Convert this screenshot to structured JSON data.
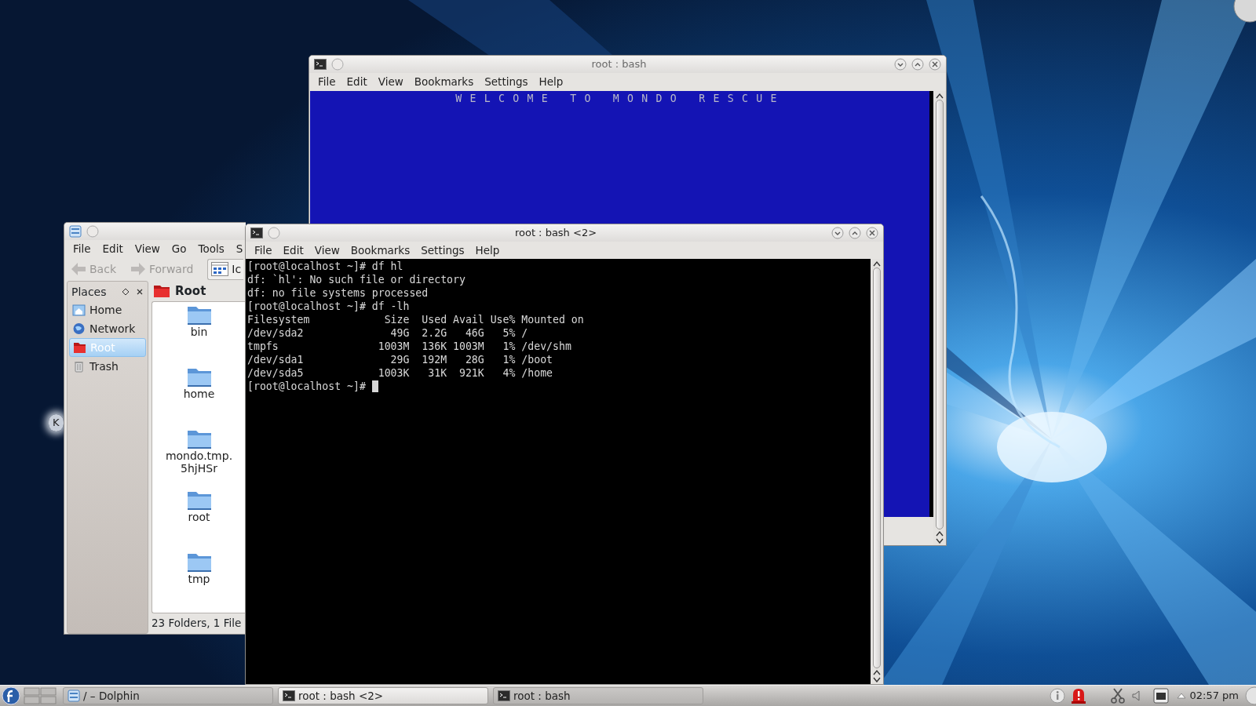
{
  "desktop": {
    "kind": "picture",
    "icon_labels": [
      "K"
    ]
  },
  "windows": [
    {
      "kind": "terminal",
      "title": "root : bash",
      "active": false,
      "menu": [
        "File",
        "Edit",
        "View",
        "Bookmarks",
        "Settings",
        "Help"
      ],
      "banner": "WELCOME TO MONDO RESCUE"
    },
    {
      "kind": "file_manager",
      "menu": [
        "File",
        "Edit",
        "View",
        "Go",
        "Tools",
        "S"
      ],
      "toolbar": [
        {
          "label": "Back",
          "kind": "back",
          "disabled": true
        },
        {
          "label": "Forward",
          "kind": "forward",
          "disabled": true
        },
        {
          "label": "Ic",
          "kind": "view_mode",
          "disabled": false
        }
      ],
      "places": {
        "title": "Places",
        "items": [
          {
            "label": "Home",
            "kind": "home",
            "selected": false
          },
          {
            "label": "Network",
            "kind": "network",
            "selected": false
          },
          {
            "label": "Root",
            "kind": "root",
            "selected": true
          },
          {
            "label": "Trash",
            "kind": "trash",
            "selected": false
          }
        ]
      },
      "location": "Root",
      "files": [
        "bin",
        "home",
        "mondo.tmp.5hjHSr",
        "root",
        "tmp"
      ],
      "status": "23 Folders, 1 File"
    },
    {
      "kind": "terminal",
      "title": "root : bash <2>",
      "active": true,
      "menu": [
        "File",
        "Edit",
        "View",
        "Bookmarks",
        "Settings",
        "Help"
      ],
      "lines": [
        "[root@localhost ~]# df hl",
        "df: `hl': No such file or directory",
        "df: no file systems processed",
        "[root@localhost ~]# df -lh",
        "Filesystem            Size  Used Avail Use% Mounted on",
        "/dev/sda2              49G  2.2G   46G   5% /",
        "tmpfs                1003M  136K 1003M   1% /dev/shm",
        "/dev/sda1              29G  192M   28G   1% /boot",
        "/dev/sda5            1003K   31K  921K   4% /home",
        "[root@localhost ~]#"
      ]
    }
  ],
  "taskbar": {
    "tasks": [
      {
        "label": "/ – Dolphin",
        "kind": "file_manager",
        "selected": false
      },
      {
        "label": "root : bash <2>",
        "kind": "terminal",
        "selected": true
      },
      {
        "label": "root : bash",
        "kind": "terminal",
        "selected": false
      }
    ],
    "clock": "02:57 pm"
  }
}
